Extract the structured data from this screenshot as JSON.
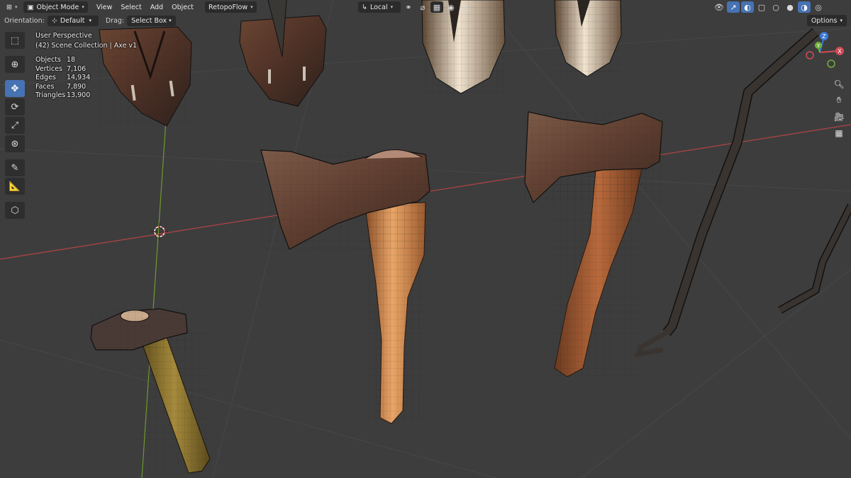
{
  "header": {
    "editor_type_icon": "3d-viewport-icon",
    "mode": "Object Mode",
    "menus": [
      "View",
      "Select",
      "Add",
      "Object"
    ],
    "addon_menu": "RetopoFlow",
    "transform_orientation": "Local",
    "right_icons": [
      "visibility-icon",
      "gizmo-icon",
      "overlay-icon",
      "xray-icon",
      "wireframe-shading-icon",
      "solid-shading-icon",
      "material-shading-icon",
      "rendered-shading-icon"
    ]
  },
  "tool_settings": {
    "orientation_label": "Orientation:",
    "orientation_value": "Default",
    "drag_label": "Drag:",
    "drag_value": "Select Box",
    "options_label": "Options"
  },
  "overlay": {
    "view_name": "User Perspective",
    "collection": "(42) Scene Collection | Axe v1",
    "stats": [
      {
        "label": "Objects",
        "value": "18"
      },
      {
        "label": "Vertices",
        "value": "7,106"
      },
      {
        "label": "Edges",
        "value": "14,934"
      },
      {
        "label": "Faces",
        "value": "7,890"
      },
      {
        "label": "Triangles",
        "value": "13,900"
      }
    ]
  },
  "toolbar": {
    "tools": [
      "select-box-icon",
      "cursor-icon",
      "move-icon",
      "rotate-icon",
      "scale-icon",
      "transform-icon",
      "annotate-icon",
      "measure-icon",
      "add-cube-icon"
    ],
    "active_tool": "move-icon"
  },
  "navigation": {
    "axes": [
      "Z",
      "Y",
      "X"
    ],
    "buttons": [
      "zoom-icon",
      "pan-hand-icon",
      "camera-view-icon",
      "perspective-grid-icon"
    ]
  },
  "colors": {
    "background": "#3d3d3d",
    "x_axis": "#b34444",
    "y_axis": "#6c9a2e",
    "active_blue": "#4772b3"
  }
}
